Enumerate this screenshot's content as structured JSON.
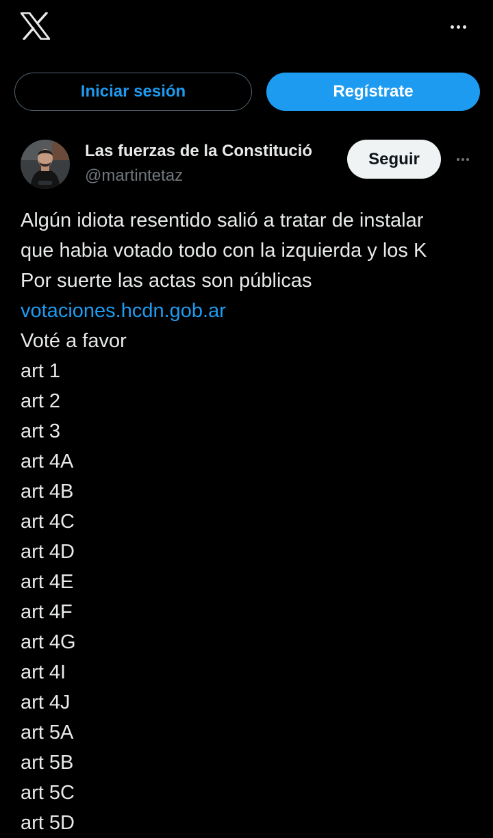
{
  "header": {
    "logo_icon": "x-logo-icon",
    "more_icon": "more-horizontal-icon"
  },
  "auth": {
    "login_label": "Iniciar sesión",
    "signup_label": "Regístrate"
  },
  "post": {
    "author": {
      "display_name": "Las fuerzas de la Constitució",
      "handle": "@martintetaz"
    },
    "follow_label": "Seguir",
    "more_icon": "more-horizontal-icon",
    "lines": [
      "Algún idiota resentido salió a tratar de instalar",
      "que habia votado todo con la izquierda y los K",
      "Por suerte las actas son públicas"
    ],
    "link_text": "votaciones.hcdn.gob.ar",
    "list_intro": "Voté a favor",
    "articles": [
      "art 1",
      "art 2",
      "art 3",
      "art 4A",
      "art 4B",
      "art 4C",
      "art 4D",
      "art 4E",
      "art 4F",
      "art 4G",
      "art 4I",
      "art 4J",
      "art 5A",
      "art 5B",
      "art 5C",
      "art 5D"
    ]
  },
  "colors": {
    "background": "#000000",
    "text": "#e7e9ea",
    "secondary_text": "#71767b",
    "accent": "#1d9bf0",
    "follow_button_bg": "#eff3f4"
  }
}
